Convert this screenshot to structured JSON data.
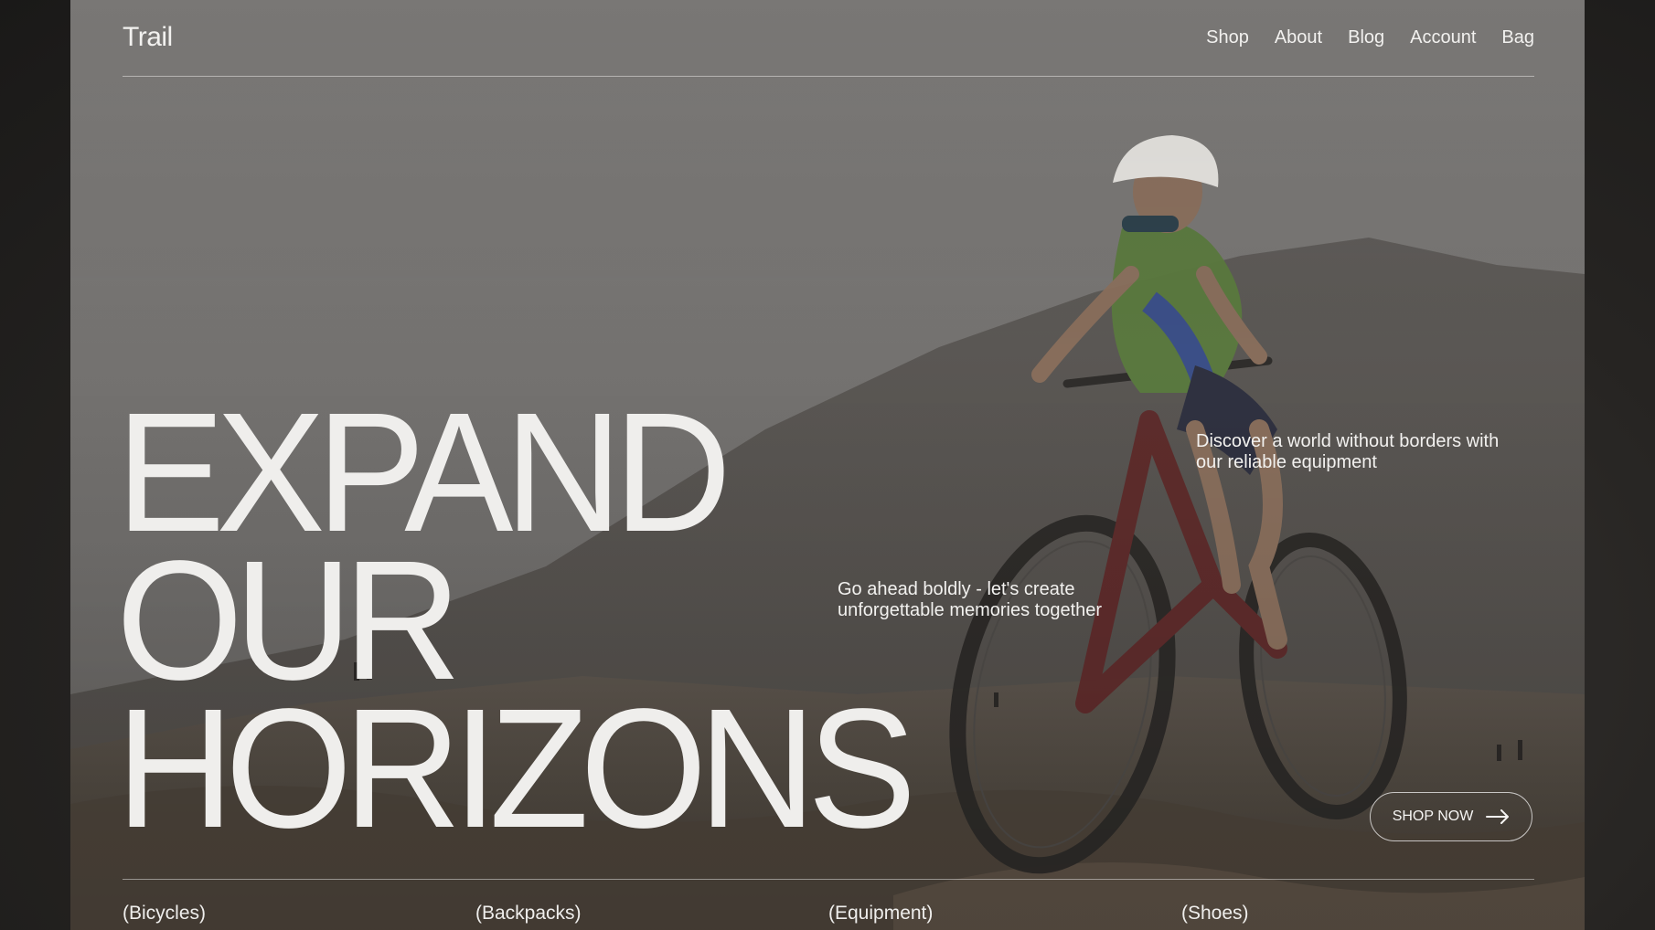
{
  "brand": {
    "logo": "Trail"
  },
  "nav": {
    "items": [
      {
        "label": "Shop"
      },
      {
        "label": "About"
      },
      {
        "label": "Blog"
      },
      {
        "label": "Account"
      },
      {
        "label": "Bag"
      }
    ]
  },
  "hero": {
    "headline_lines": [
      "EXPAND",
      "OUR",
      "HORIZONS"
    ],
    "tagline_right": "Discover a world without borders with our reliable equipment",
    "tagline_mid": "Go ahead boldly - let's create unforgettable memories together",
    "cta_label": "SHOP NOW",
    "cta_icon": "arrow-right-icon",
    "image": "mountain-biker-photo"
  },
  "categories": [
    {
      "label": "(Bicycles)"
    },
    {
      "label": "(Backpacks)"
    },
    {
      "label": "(Equipment)"
    },
    {
      "label": "(Shoes)"
    }
  ],
  "colors": {
    "text": "#efeeec",
    "page_bg": "#1e1c1a",
    "line": "#ffffff"
  }
}
